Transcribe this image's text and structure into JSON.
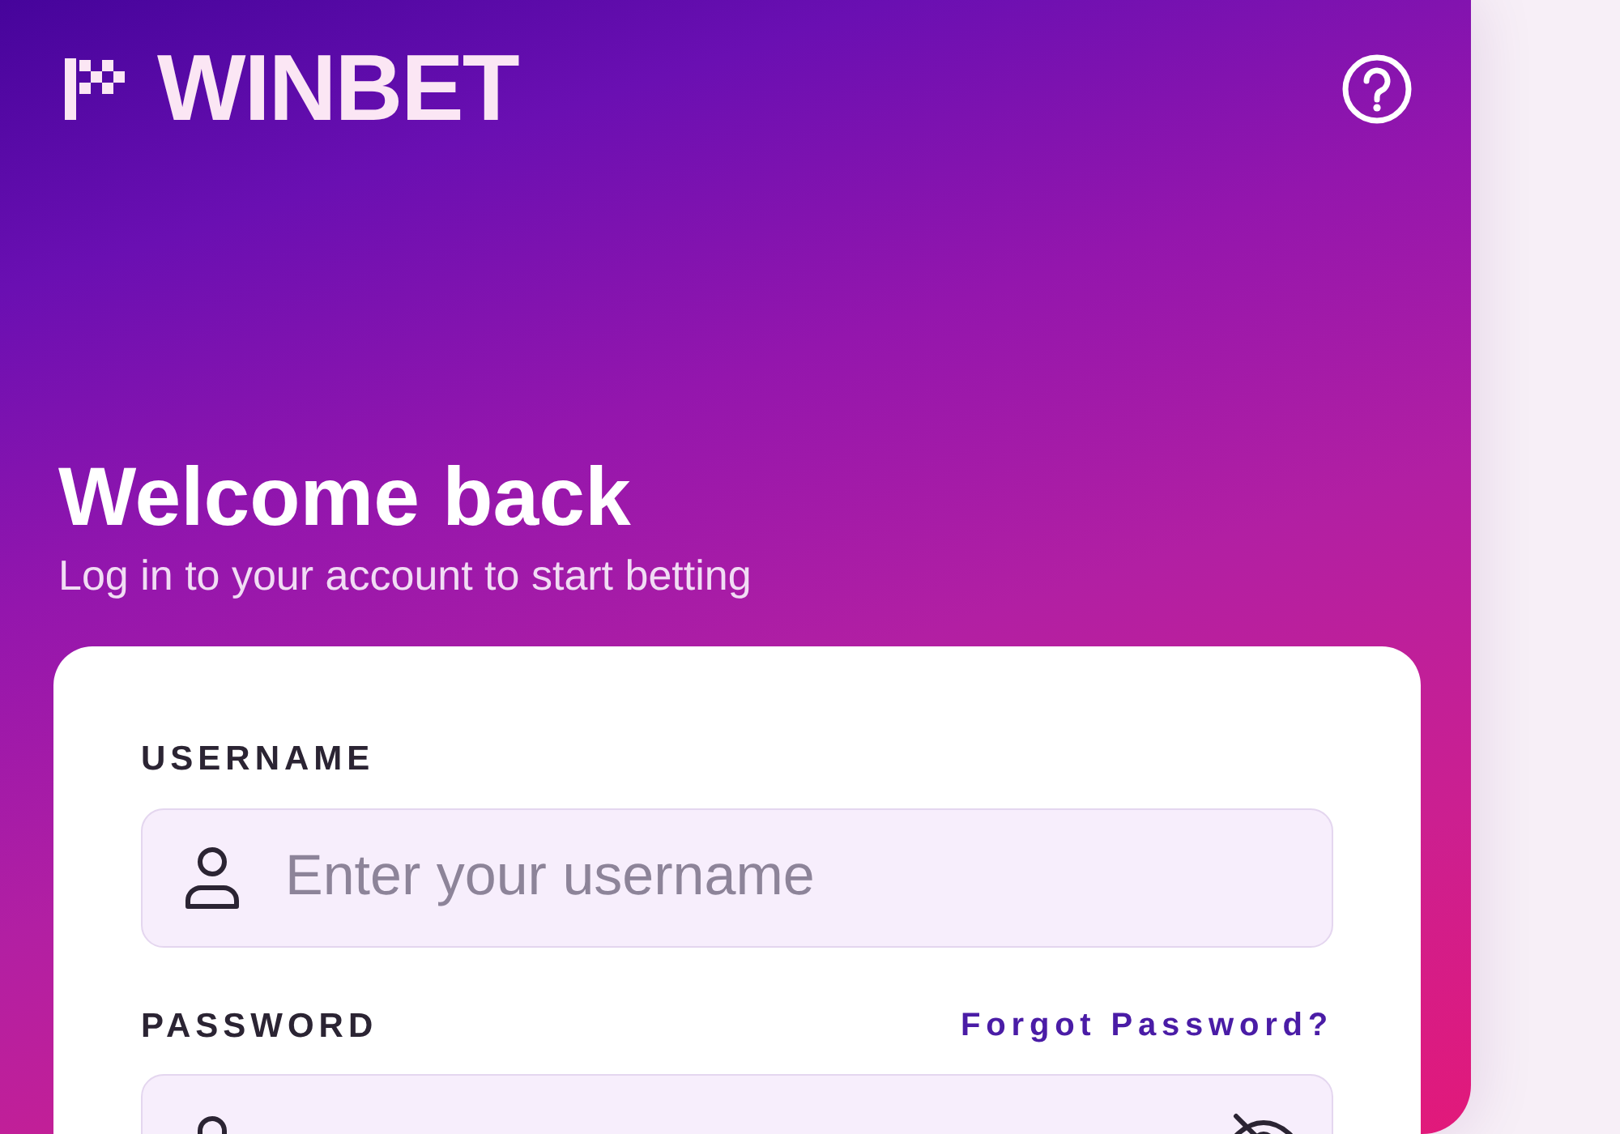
{
  "brand": {
    "name": "WINBET"
  },
  "welcome": {
    "title": "Welcome back",
    "subtitle": "Log in to your account to start betting"
  },
  "form": {
    "fields": [
      {
        "kind": "text",
        "label": "USERNAME",
        "placeholder": "Enter your username"
      },
      {
        "kind": "password",
        "label": "PASSWORD",
        "link": "Forgot Password?"
      }
    ]
  }
}
